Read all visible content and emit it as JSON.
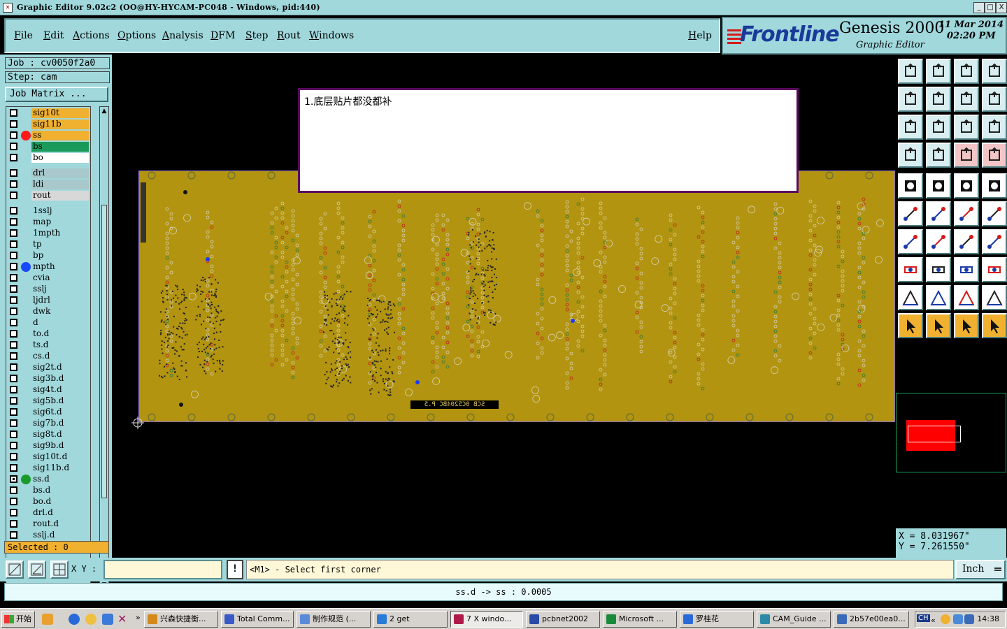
{
  "window": {
    "title": "Graphic Editor 9.02c2  (OO@HY-HYCAM-PC048 - Windows, pid:440)",
    "minimize": "_",
    "maximize": "□",
    "close": "X"
  },
  "menu": {
    "items": [
      "File",
      "Edit",
      "Actions",
      "Options",
      "Analysis",
      "DFM",
      "Step",
      "Rout",
      "Windows"
    ],
    "help": "Help"
  },
  "brand": {
    "logo": "Frontline",
    "product": "Genesis 2000",
    "subtitle": "Graphic Editor",
    "date": "11 Mar 2014",
    "time": "02:20 PM"
  },
  "job": {
    "job_line": "Job : cv0050f2a0",
    "step_line": "Step: cam",
    "matrix_button": "Job Matrix ..."
  },
  "layers": [
    {
      "name": "sig10t",
      "bg": "#f0b030",
      "checked": false,
      "dot": ""
    },
    {
      "name": "sig11b",
      "bg": "#f0b030",
      "checked": false,
      "dot": ""
    },
    {
      "name": "ss",
      "bg": "#f0b030",
      "checked": false,
      "dot": "#ff1a1a"
    },
    {
      "name": "bs",
      "bg": "#1a9a5a",
      "checked": false,
      "dot": ""
    },
    {
      "name": "bo",
      "bg": "#ffffff",
      "checked": false,
      "dot": ""
    },
    {
      "name": "drl",
      "bg": "#a8c8cc",
      "checked": false,
      "dot": ""
    },
    {
      "name": "ldi",
      "bg": "#a8c8cc",
      "checked": false,
      "dot": ""
    },
    {
      "name": "rout",
      "bg": "#d8d8d8",
      "checked": false,
      "dot": ""
    },
    {
      "name": "1sslj",
      "bg": "#a0d8dc",
      "checked": false,
      "dot": ""
    },
    {
      "name": "map",
      "bg": "#a0d8dc",
      "checked": false,
      "dot": ""
    },
    {
      "name": "1mpth",
      "bg": "#a0d8dc",
      "checked": false,
      "dot": ""
    },
    {
      "name": "tp",
      "bg": "#a0d8dc",
      "checked": false,
      "dot": ""
    },
    {
      "name": "bp",
      "bg": "#a0d8dc",
      "checked": false,
      "dot": ""
    },
    {
      "name": "mpth",
      "bg": "#a0d8dc",
      "checked": false,
      "dot": "#1a4aff"
    },
    {
      "name": "cvia",
      "bg": "#a0d8dc",
      "checked": false,
      "dot": ""
    },
    {
      "name": "sslj",
      "bg": "#a0d8dc",
      "checked": false,
      "dot": ""
    },
    {
      "name": "ljdrl",
      "bg": "#a0d8dc",
      "checked": false,
      "dot": ""
    },
    {
      "name": "dwk",
      "bg": "#a0d8dc",
      "checked": false,
      "dot": ""
    },
    {
      "name": "d",
      "bg": "#a0d8dc",
      "checked": false,
      "dot": ""
    },
    {
      "name": "to.d",
      "bg": "#a0d8dc",
      "checked": false,
      "dot": ""
    },
    {
      "name": "ts.d",
      "bg": "#a0d8dc",
      "checked": false,
      "dot": ""
    },
    {
      "name": "cs.d",
      "bg": "#a0d8dc",
      "checked": false,
      "dot": ""
    },
    {
      "name": "sig2t.d",
      "bg": "#a0d8dc",
      "checked": false,
      "dot": ""
    },
    {
      "name": "sig3b.d",
      "bg": "#a0d8dc",
      "checked": false,
      "dot": ""
    },
    {
      "name": "sig4t.d",
      "bg": "#a0d8dc",
      "checked": false,
      "dot": ""
    },
    {
      "name": "sig5b.d",
      "bg": "#a0d8dc",
      "checked": false,
      "dot": ""
    },
    {
      "name": "sig6t.d",
      "bg": "#a0d8dc",
      "checked": false,
      "dot": ""
    },
    {
      "name": "sig7b.d",
      "bg": "#a0d8dc",
      "checked": false,
      "dot": ""
    },
    {
      "name": "sig8t.d",
      "bg": "#a0d8dc",
      "checked": false,
      "dot": ""
    },
    {
      "name": "sig9b.d",
      "bg": "#a0d8dc",
      "checked": false,
      "dot": ""
    },
    {
      "name": "sig10t.d",
      "bg": "#a0d8dc",
      "checked": false,
      "dot": ""
    },
    {
      "name": "sig11b.d",
      "bg": "#a0d8dc",
      "checked": false,
      "dot": ""
    },
    {
      "name": "ss.d",
      "bg": "#a0d8dc",
      "checked": true,
      "dot": "#1a9a2a"
    },
    {
      "name": "bs.d",
      "bg": "#a0d8dc",
      "checked": false,
      "dot": ""
    },
    {
      "name": "bo.d",
      "bg": "#a0d8dc",
      "checked": false,
      "dot": ""
    },
    {
      "name": "drl.d",
      "bg": "#a0d8dc",
      "checked": false,
      "dot": ""
    },
    {
      "name": "rout.d",
      "bg": "#a0d8dc",
      "checked": false,
      "dot": ""
    },
    {
      "name": "sslj.d",
      "bg": "#a0d8dc",
      "checked": false,
      "dot": ""
    }
  ],
  "selected": "Selected : 0",
  "note": {
    "text": "1.底层贴片都没都补"
  },
  "board": {
    "silkscreen_label": "SCB 0C5204BC  P.5",
    "board_color": "#b29410"
  },
  "toolbar_icons": [
    "home-up-icon",
    "home-down-icon",
    "home-icon",
    "window-split-icon",
    "zoom-left-icon",
    "zoom-right-icon",
    "undo-icon",
    "rotate-icon",
    "fit-window-icon",
    "fit-profile-icon",
    "one-to-one-icon",
    "help-icon",
    "tools-icon",
    "grid-icon",
    "snap-red-icon",
    "snap-red2-icon",
    "pad-icon",
    "outline-icon",
    "ruler-icon",
    "circle-icon",
    "nodes-icon",
    "cross-icon",
    "line-node-icon",
    "line-node-red-icon",
    "angle-icon",
    "slash-icon",
    "curve-icon",
    "ff-icon",
    "square-dot-icon",
    "minus-icon",
    "measure-icon",
    "pads-icon",
    "triangle-icon",
    "arrow-up-icon",
    "arrow-up-bold-icon",
    "arrow-up-blue-icon",
    "pointer-icon",
    "pointer-square-icon",
    "pointer-circle-icon",
    "pointer-graph-icon"
  ],
  "coords": {
    "x": "X  =  8.031967\"",
    "y": "Y  =  7.261550\""
  },
  "command": {
    "xy_label": "X Y :",
    "xy_value": "",
    "bang": "!",
    "prompt": "<M1> - Select first corner",
    "unit": "Inch"
  },
  "status": "ss.d -> ss : 0.0005",
  "taskbar": {
    "start": "开始",
    "tasks": [
      {
        "label": "兴森快捷衡...",
        "color": "#d48a1a",
        "active": false
      },
      {
        "label": "Total Comm...",
        "color": "#3a5ac8",
        "active": false
      },
      {
        "label": "制作规范 (...",
        "color": "#5a8ad8",
        "active": false
      },
      {
        "label": "2 get",
        "color": "#2a7ad8",
        "active": false
      },
      {
        "label": "7 X windo...",
        "color": "#b01a4a",
        "active": true
      },
      {
        "label": "pcbnet2002",
        "color": "#2a4aa8",
        "active": false
      },
      {
        "label": "Microsoft ...",
        "color": "#1a8a3a",
        "active": false
      },
      {
        "label": "罗桂花",
        "color": "#2a6ad8",
        "active": false
      },
      {
        "label": "CAM_Guide ...",
        "color": "#2a8aa8",
        "active": false
      },
      {
        "label": "2b57e00ea0...",
        "color": "#3a6ab8",
        "active": false
      }
    ],
    "clock": "14:38",
    "tray_label": "CH"
  }
}
